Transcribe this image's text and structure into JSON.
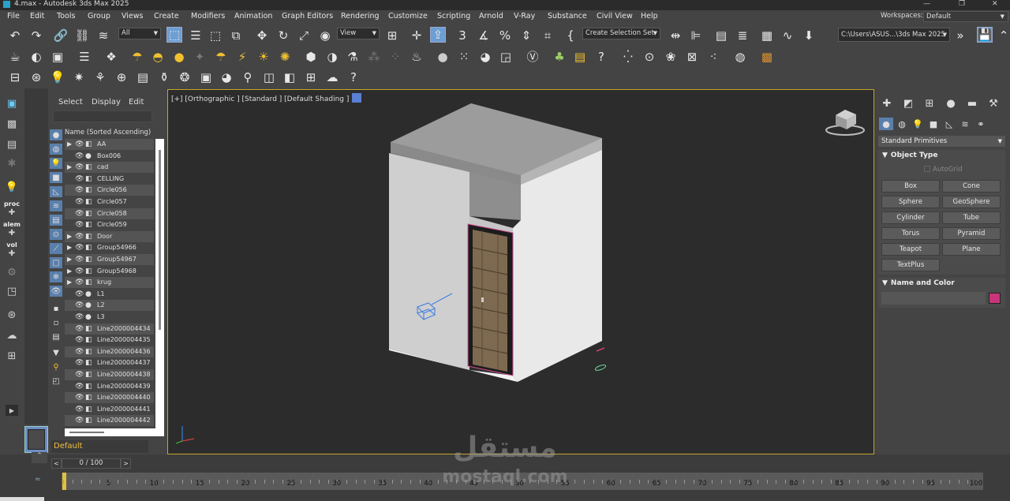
{
  "window": {
    "title": "4.max - Autodesk 3ds Max 2025"
  },
  "menus": [
    "File",
    "Edit",
    "Tools",
    "Group",
    "Views",
    "Create",
    "Modifiers",
    "Animation",
    "Graph Editors",
    "Rendering",
    "Customize",
    "Scripting",
    "Arnold",
    "V-Ray",
    "Substance",
    "Civil View",
    "Help"
  ],
  "workspaces": {
    "label": "Workspaces:",
    "value": "Default"
  },
  "toolbar": {
    "filter": "All",
    "ref_coord": "View",
    "selection_set": "Create Selection Set",
    "project_path": "C:\\Users\\ASUS...\\3ds Max 2025"
  },
  "left_bar": {
    "proc": "proc",
    "alem": "alem",
    "vol": "vol"
  },
  "scene_explorer": {
    "tabs": [
      "Select",
      "Display",
      "Edit"
    ],
    "column_header": "Name (Sorted Ascending)",
    "items": [
      {
        "name": "AA",
        "expand": "▶",
        "type": "◧"
      },
      {
        "name": "Box006",
        "expand": "",
        "type": "●"
      },
      {
        "name": "cad",
        "expand": "▶",
        "type": "◧"
      },
      {
        "name": "CELLING",
        "expand": "",
        "type": "◧"
      },
      {
        "name": "Circle056",
        "expand": "",
        "type": "◧"
      },
      {
        "name": "Circle057",
        "expand": "",
        "type": "◧"
      },
      {
        "name": "Circle058",
        "expand": "",
        "type": "◧"
      },
      {
        "name": "Circle059",
        "expand": "",
        "type": "◧"
      },
      {
        "name": "Door",
        "expand": "▶",
        "type": "◧"
      },
      {
        "name": "Group54966",
        "expand": "▶",
        "type": "◧"
      },
      {
        "name": "Group54967",
        "expand": "▶",
        "type": "◧"
      },
      {
        "name": "Group54968",
        "expand": "▶",
        "type": "◧"
      },
      {
        "name": "krug",
        "expand": "▶",
        "type": "◧"
      },
      {
        "name": "L1",
        "expand": "",
        "type": "●"
      },
      {
        "name": "L2",
        "expand": "",
        "type": "●"
      },
      {
        "name": "L3",
        "expand": "",
        "type": "●"
      },
      {
        "name": "Line2000004434",
        "expand": "",
        "type": "◧"
      },
      {
        "name": "Line2000004435",
        "expand": "",
        "type": "◧"
      },
      {
        "name": "Line2000004436",
        "expand": "",
        "type": "◧"
      },
      {
        "name": "Line2000004437",
        "expand": "",
        "type": "◧"
      },
      {
        "name": "Line2000004438",
        "expand": "",
        "type": "◧"
      },
      {
        "name": "Line2000004439",
        "expand": "",
        "type": "◧"
      },
      {
        "name": "Line2000004440",
        "expand": "",
        "type": "◧"
      },
      {
        "name": "Line2000004441",
        "expand": "",
        "type": "◧"
      },
      {
        "name": "Line2000004442",
        "expand": "",
        "type": "◧"
      }
    ]
  },
  "layer": {
    "name": "Default"
  },
  "viewport": {
    "label": "[+] [Orthographic ] [Standard ] [Default Shading ]"
  },
  "command_panel": {
    "category": "Standard Primitives",
    "object_type_title": "Object Type",
    "autogrid": "AutoGrid",
    "buttons": [
      "Box",
      "Cone",
      "Sphere",
      "GeoSphere",
      "Cylinder",
      "Tube",
      "Torus",
      "Pyramid",
      "Teapot",
      "Plane",
      "TextPlus"
    ],
    "name_color_title": "Name and Color",
    "object_color": "#c8357a"
  },
  "timeline": {
    "frame_display": "0 / 100",
    "ticks": [
      "0",
      "5",
      "10",
      "15",
      "20",
      "25",
      "30",
      "35",
      "40",
      "45",
      "50",
      "55",
      "60",
      "65",
      "70",
      "75",
      "80",
      "85",
      "90",
      "95",
      "100"
    ]
  },
  "watermark": {
    "arabic": "مستقل",
    "latin": "mostaql.com"
  }
}
